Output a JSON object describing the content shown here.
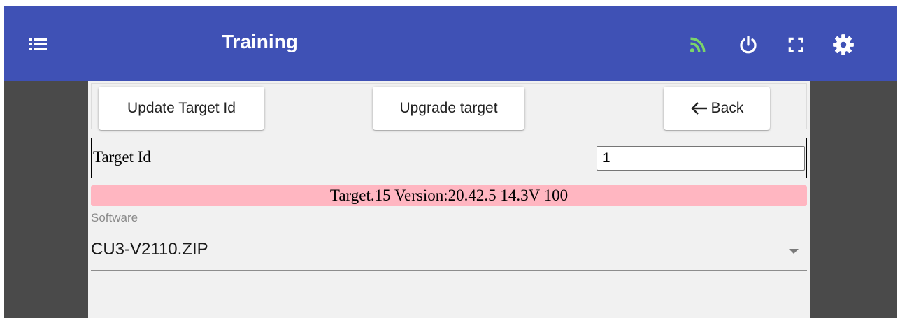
{
  "app_bar": {
    "title": "Training",
    "menu_icon": "list-icon",
    "actions": [
      {
        "name": "rss-feed-icon",
        "color": "#7bd46a"
      },
      {
        "name": "power-icon",
        "color": "#ffffff"
      },
      {
        "name": "fullscreen-icon",
        "color": "#ffffff"
      },
      {
        "name": "gear-icon",
        "color": "#ffffff"
      }
    ],
    "background": "#3f51b5"
  },
  "toolbar": {
    "update_target_label": "Update Target Id",
    "upgrade_target_label": "Upgrade target",
    "back_label": "Back",
    "back_icon": "arrow-left-icon"
  },
  "target_row": {
    "label": "Target Id",
    "value": "1"
  },
  "status": {
    "text": "Target.15 Version:20.42.5 14.3V 100",
    "color": "#ffb6c1"
  },
  "software": {
    "label": "Software",
    "selected": "CU3-V2110.ZIP"
  }
}
